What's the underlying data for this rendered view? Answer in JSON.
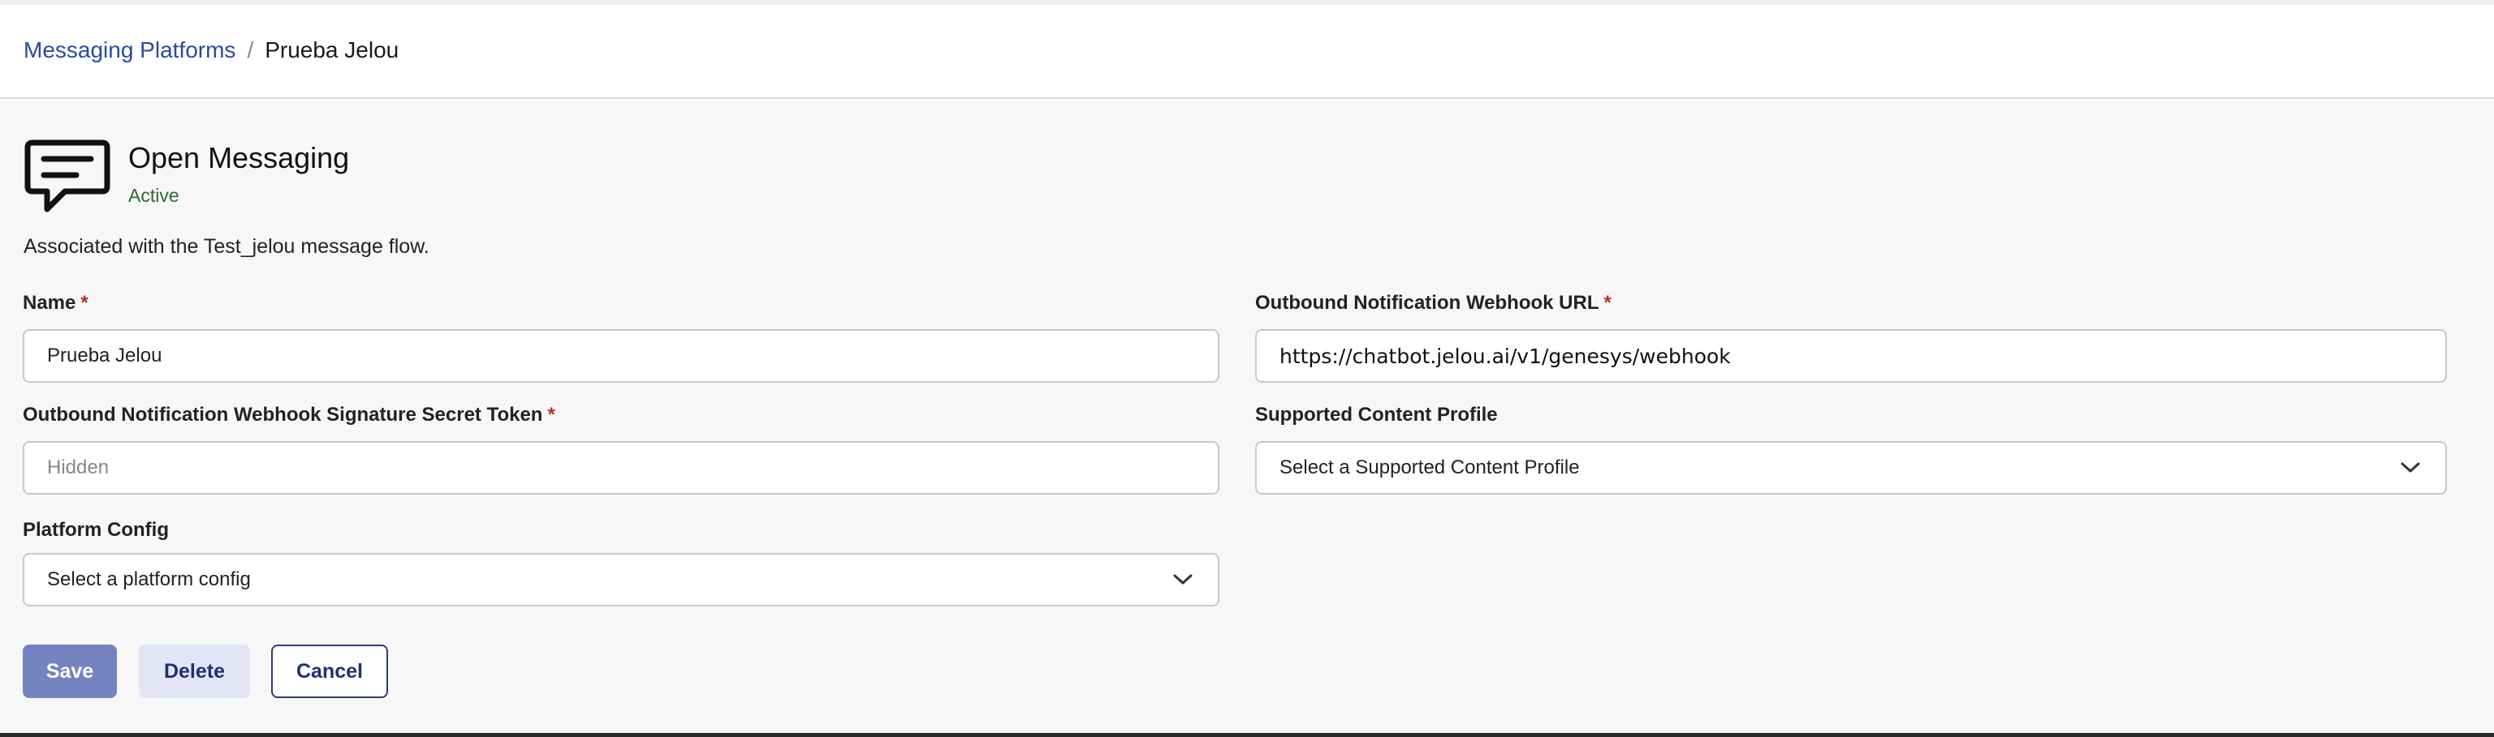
{
  "breadcrumb": {
    "parent": "Messaging Platforms",
    "separator": "/",
    "current": "Prueba Jelou"
  },
  "integration": {
    "icon": "chat-message-icon",
    "title": "Open Messaging",
    "status": "Active",
    "association": "Associated with the Test_jelou message flow."
  },
  "form": {
    "required_marker": "*",
    "name": {
      "label": "Name",
      "value": "Prueba Jelou"
    },
    "webhook_url": {
      "label": "Outbound Notification Webhook URL",
      "value": "https://chatbot.jelou.ai/v1/genesys/webhook"
    },
    "secret_token": {
      "label": "Outbound Notification Webhook Signature Secret Token",
      "placeholder": "Hidden"
    },
    "content_profile": {
      "label": "Supported Content Profile",
      "placeholder": "Select a Supported Content Profile"
    },
    "platform_config": {
      "label": "Platform Config",
      "placeholder": "Select a platform config"
    }
  },
  "actions": {
    "save": "Save",
    "delete": "Delete",
    "cancel": "Cancel"
  },
  "colors": {
    "link": "#2a4aa0",
    "status_active": "#2e6b2e",
    "required": "#c0282b",
    "save_button": "#7584c0",
    "delete_button": "#e3e5f7",
    "cancel_border": "#2a3a7a"
  }
}
